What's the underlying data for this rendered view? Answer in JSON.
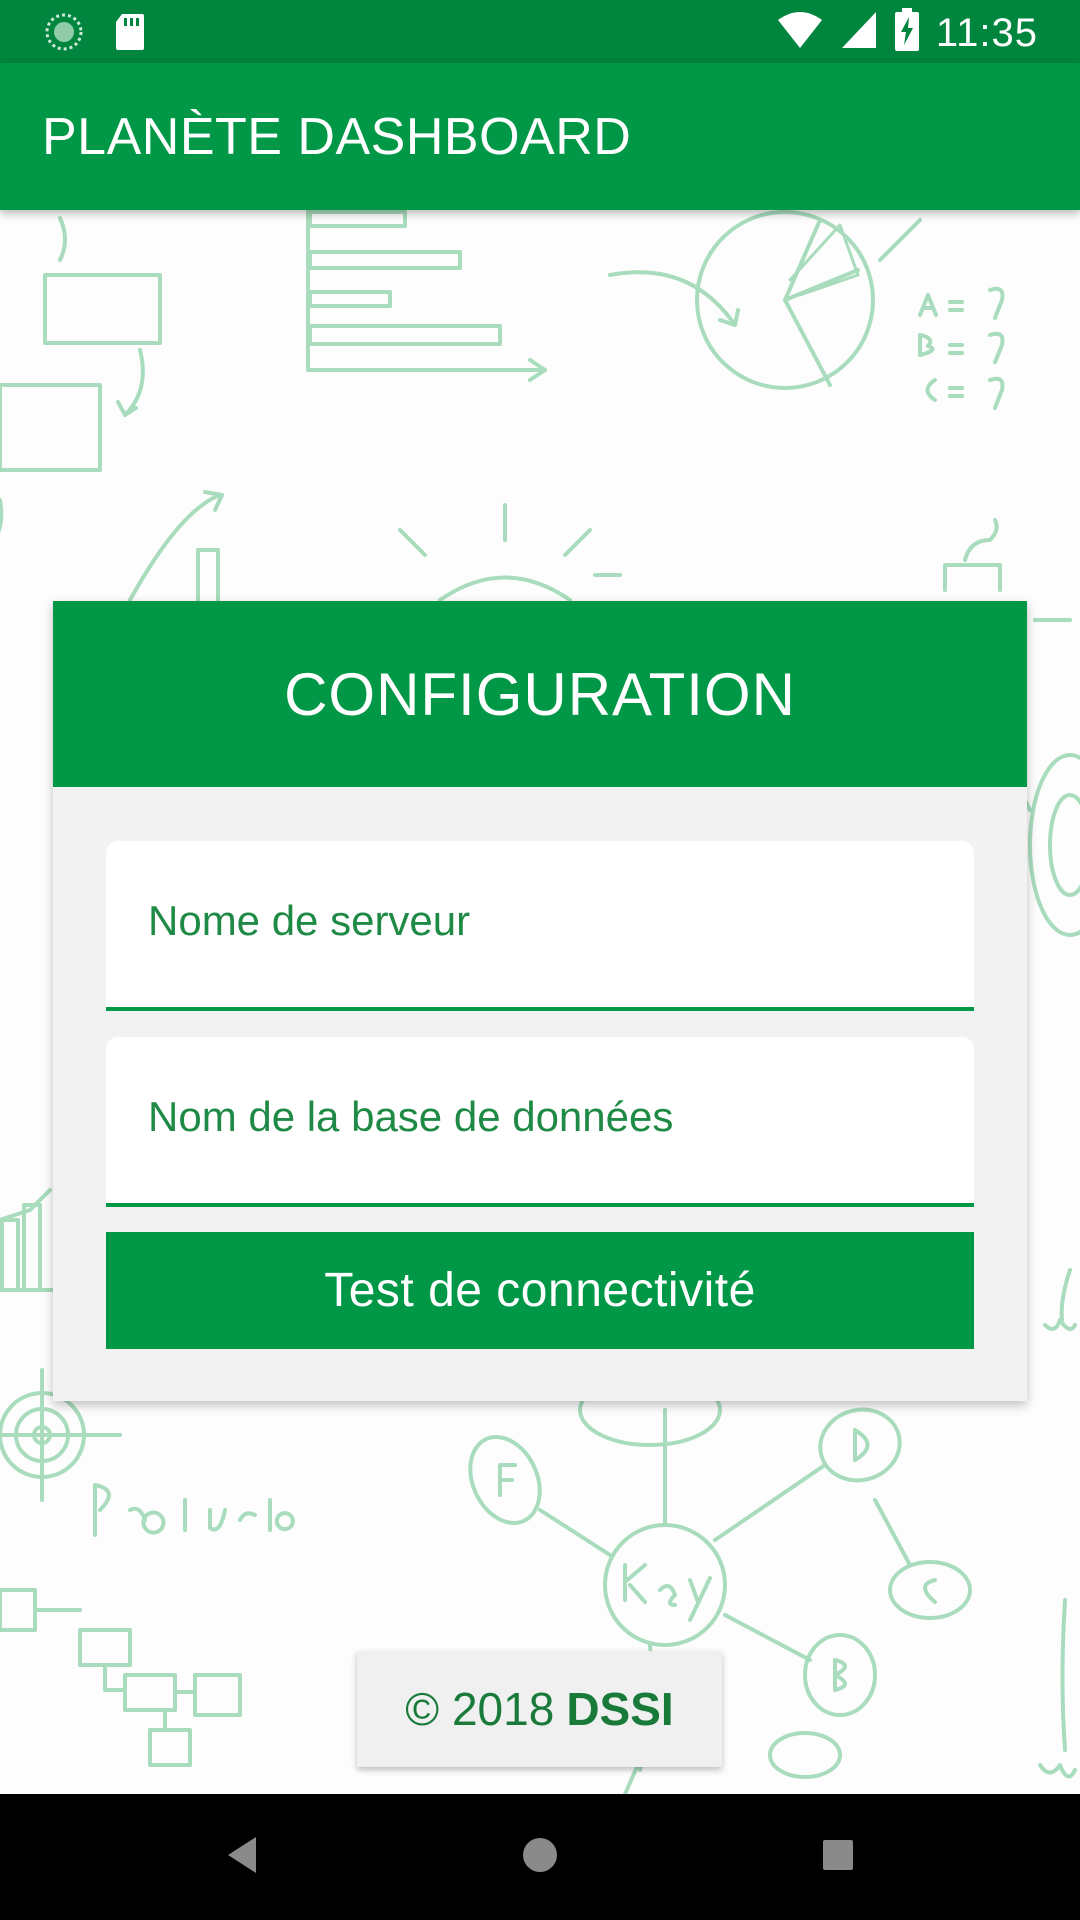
{
  "status_bar": {
    "time": "11:35",
    "icons": [
      "sync-icon",
      "sd-card-icon",
      "wifi-icon",
      "signal-icon",
      "battery-charging-icon"
    ]
  },
  "app_bar": {
    "title": "PLANÈTE DASHBOARD"
  },
  "card": {
    "title": "CONFIGURATION",
    "server_field": {
      "placeholder": "Nome de serveur",
      "value": ""
    },
    "database_field": {
      "placeholder": "Nom de la base de données",
      "value": ""
    },
    "test_button_label": "Test de connectivité"
  },
  "footer": {
    "copyright": "© 2018",
    "brand": "DSSI"
  },
  "nav_bar": {
    "icons": [
      "back-icon",
      "home-icon",
      "recents-icon"
    ]
  },
  "colors": {
    "status_bar": "#00853e",
    "primary": "#009846",
    "card_background": "#f2f2f2",
    "text_green": "#1a7a3a",
    "sketch_lines": "#a8dcbc"
  }
}
